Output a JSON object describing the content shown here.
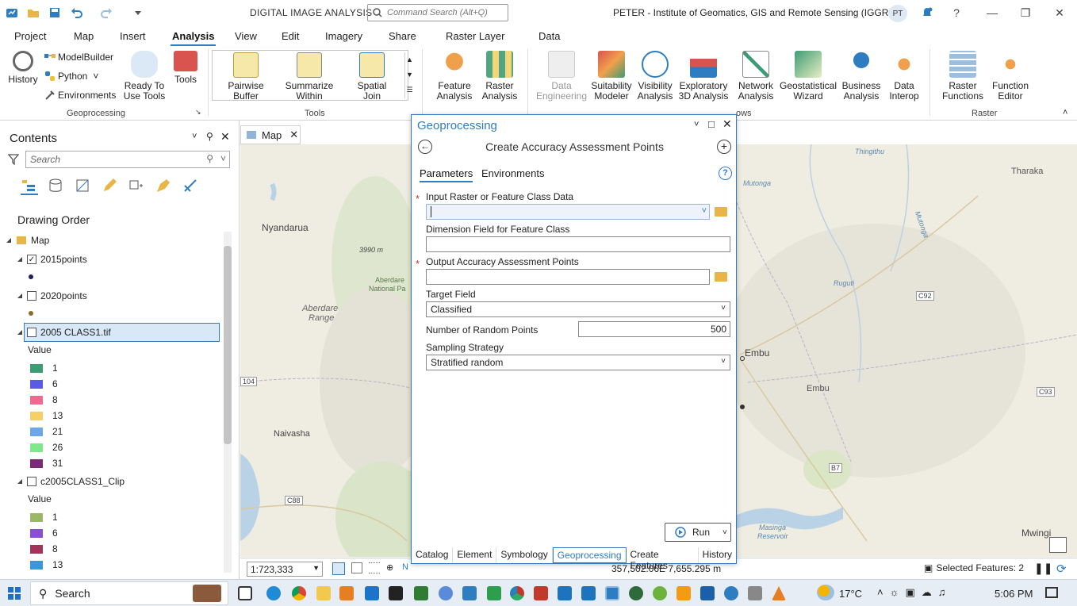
{
  "titlebar": {
    "app_title": "DIGITAL IMAGE ANALYSIS",
    "command_placeholder": "Command Search (Alt+Q)",
    "user_title": "PETER - Institute of Geomatics, GIS and Remote Sensing (IGGReS)",
    "avatar_initials": "PT"
  },
  "tabs": [
    "Project",
    "Map",
    "Insert",
    "Analysis",
    "View",
    "Edit",
    "Imagery",
    "Share",
    "Raster Layer",
    "Data"
  ],
  "ribbon": {
    "history": "History",
    "modelbuilder": "ModelBuilder",
    "python": "Python",
    "environments": "Environments",
    "ready_to_use_1": "Ready To",
    "ready_to_use_2": "Use Tools",
    "tools": "Tools",
    "geoprocessing_group": "Geoprocessing",
    "pairwise_buffer_1": "Pairwise",
    "pairwise_buffer_2": "Buffer",
    "summarize_within_1": "Summarize",
    "summarize_within_2": "Within",
    "spatial_join_1": "Spatial",
    "spatial_join_2": "Join",
    "tools_group": "Tools",
    "feature_analysis_1": "Feature",
    "feature_analysis_2": "Analysis",
    "raster_analysis_1": "Raster",
    "raster_analysis_2": "Analysis",
    "data_engineering_1": "Data",
    "data_engineering_2": "Engineering",
    "suitability_modeler_1": "Suitability",
    "suitability_modeler_2": "Modeler",
    "visibility_analysis_1": "Visibility",
    "visibility_analysis_2": "Analysis",
    "exploratory_1": "Exploratory",
    "exploratory_2": "3D Analysis",
    "network_1": "Network",
    "network_2": "Analysis",
    "geostatistical_1": "Geostatistical",
    "geostatistical_2": "Wizard",
    "business_1": "Business",
    "business_2": "Analysis",
    "interop_1": "Data",
    "interop_2": "Interop",
    "workflows_group": "ows",
    "raster_functions_1": "Raster",
    "raster_functions_2": "Functions",
    "function_editor_1": "Function",
    "function_editor_2": "Editor",
    "raster_group": "Raster"
  },
  "contents": {
    "title": "Contents",
    "search_placeholder": "Search",
    "drawing_order": "Drawing Order",
    "map": "Map",
    "layer1": "2015points",
    "layer2": "2020points",
    "layer3": "2005 CLASS1.tif",
    "value_label": "Value",
    "layer3_values": [
      "1",
      "6",
      "8",
      "13",
      "21",
      "26",
      "31"
    ],
    "layer3_colors": [
      "#3d9c74",
      "#5a5ae6",
      "#f06a90",
      "#f5d066",
      "#6fa6e8",
      "#7ee88c",
      "#7a2a7a"
    ],
    "layer4": "c2005CLASS1_Clip",
    "layer4_values": [
      "1",
      "6",
      "8",
      "13"
    ],
    "layer4_colors": [
      "#9bb866",
      "#8a4fd4",
      "#a4335a",
      "#3a98d8"
    ]
  },
  "map": {
    "tab": "Map",
    "labels": {
      "nyandarua": "Nyandarua",
      "aberdare_np": "Aberdare",
      "aberdare_np2": "National Pa",
      "aberdare_range": "Aberdare",
      "aberdare_range2": "Range",
      "elev": "3990 m",
      "naivasha": "Naivasha",
      "embu_city": "Embu",
      "embu": "Embu",
      "tharaka": "Tharaka",
      "thingithu": "Thingithu",
      "mutonga": "Mutonga",
      "mitonga2": "Mutonga",
      "ruguti": "Ruguti",
      "masinga": "Masinga",
      "reservoir": "Reservoir",
      "mwingi": "Mwingi",
      "c92": "C92",
      "c93": "C93",
      "b7": "B7",
      "r104": "104",
      "c88": "C88"
    }
  },
  "status": {
    "scale": "1:723,333",
    "coords": "357,502.06E 7,655.295 m",
    "selected": "Selected Features: 2"
  },
  "gp": {
    "title": "Geoprocessing",
    "tool_title": "Create Accuracy Assessment Points",
    "tab_params": "Parameters",
    "tab_env": "Environments",
    "input_label": "Input Raster or Feature Class Data",
    "input_value": "",
    "dimension_label": "Dimension Field for Feature Class",
    "dimension_value": "",
    "output_label": "Output Accuracy Assessment Points",
    "output_value": "",
    "target_label": "Target Field",
    "target_value": "Classified",
    "random_label": "Number of Random Points",
    "random_value": "500",
    "sampling_label": "Sampling Strategy",
    "sampling_value": "Stratified random",
    "run": "Run",
    "bottom_tabs": [
      "Catalog",
      "Element",
      "Symbology",
      "Geoprocessing",
      "Create Features",
      "History"
    ]
  },
  "taskbar": {
    "search": "Search",
    "temp": "17°C",
    "time": "5:06 PM"
  }
}
